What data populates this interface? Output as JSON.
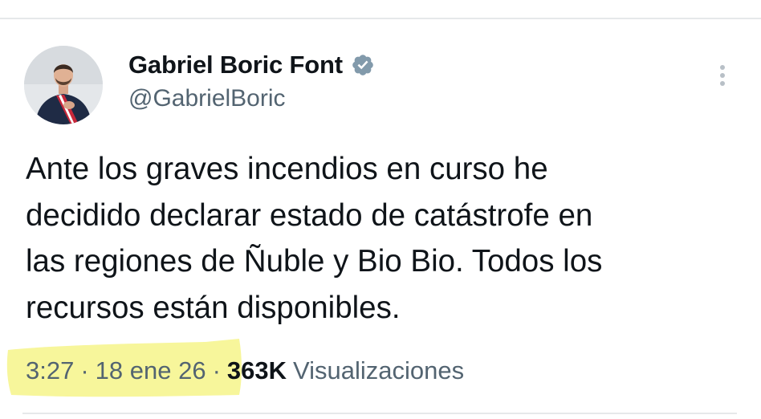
{
  "tweet": {
    "author": {
      "display_name": "Gabriel Boric Font",
      "handle": "@GabrielBoric",
      "verified_icon": "verified-badge-icon"
    },
    "text": "Ante los graves incendios en curso he\ndecidido declarar estado de catástrofe en\nlas regiones de Ñuble y Bio Bio. Todos los\nrecursos están disponibles.",
    "meta": {
      "time": "3:27",
      "separator": "·",
      "date": "18 ene 26",
      "views_count": "363K",
      "views_label": "Visualizaciones"
    },
    "more_icon": "more-vertical-icon"
  },
  "colors": {
    "verified_badge": "#829aab",
    "secondary_text": "#536471",
    "primary_text": "#0f1419",
    "highlight": "#f6f58a",
    "divider": "#e6e8ea"
  }
}
